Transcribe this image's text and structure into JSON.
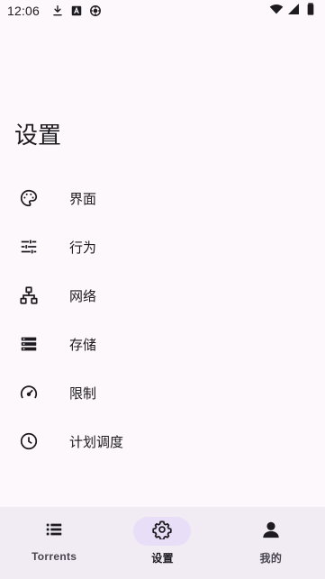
{
  "status_bar": {
    "time": "12:06",
    "icons": [
      "download-icon",
      "font-a-icon",
      "debug-icon",
      "wifi-icon",
      "signal-icon",
      "battery-icon"
    ]
  },
  "page": {
    "title": "设置"
  },
  "settings": {
    "items": [
      {
        "label": "界面",
        "icon": "palette-icon"
      },
      {
        "label": "行为",
        "icon": "tune-icon"
      },
      {
        "label": "网络",
        "icon": "network-icon"
      },
      {
        "label": "存储",
        "icon": "storage-icon"
      },
      {
        "label": "限制",
        "icon": "speed-icon"
      },
      {
        "label": "计划调度",
        "icon": "schedule-icon"
      }
    ]
  },
  "bottom_nav": {
    "items": [
      {
        "label": "Torrents",
        "icon": "list-icon",
        "active": false
      },
      {
        "label": "设置",
        "icon": "gear-icon",
        "active": true
      },
      {
        "label": "我的",
        "icon": "person-icon",
        "active": false
      }
    ]
  },
  "colors": {
    "background": "#fdf8fc",
    "nav_background": "#f1ecf4",
    "active_indicator": "#e8def8",
    "text": "#1d1b20"
  }
}
